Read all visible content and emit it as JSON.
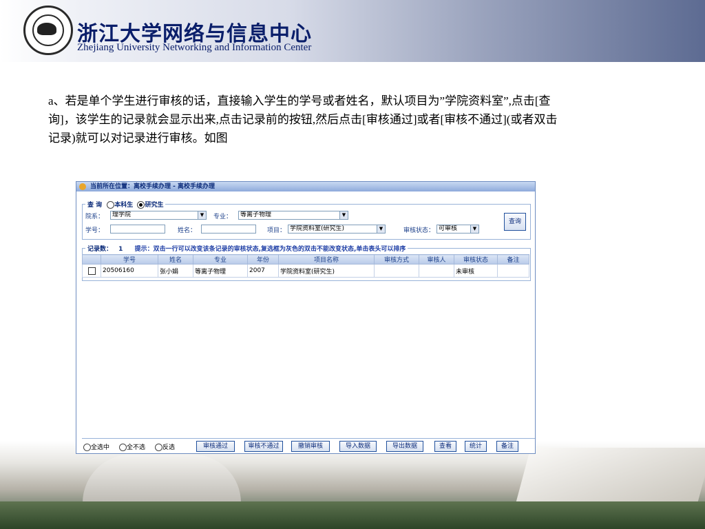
{
  "header": {
    "title_cn": "浙江大学网络与信息中心",
    "title_en": "Zhejiang University Networking and Information Center"
  },
  "paragraph": "a、若是单个学生进行审核的话，直接输入学生的学号或者姓名，默认项目为”学院资料室”,点击[查询]，该学生的记录就会显示出来,点击记录前的按钮,然后点击[审核通过]或者[审核不通过](或者双击记录)就可以对记录进行审核。如图",
  "app": {
    "location": "当前所在位置：离校手续办理 - 离校手续办理",
    "query": {
      "legend": "查 询",
      "opt_undergrad": "本科生",
      "opt_grad": "研究生",
      "dept_label": "院系：",
      "dept_value": "理学院",
      "major_label": "专业：",
      "major_value": "等离子物理",
      "id_label": "学号：",
      "id_value": "",
      "name_label": "姓名：",
      "name_value": "",
      "project_label": "项目：",
      "project_value": "学院资料室(研究生)",
      "status_label": "审核状态：",
      "status_value": "可审核",
      "query_button": "查询"
    },
    "records": {
      "count_label": "记录数：",
      "count": "1",
      "hint": "提示：双击一行可以改变该条记录的审核状态,复选框为灰色的双击不能改变状态,单击表头可以排序",
      "columns": [
        "学号",
        "姓名",
        "专业",
        "年份",
        "项目名称",
        "审核方式",
        "审核人",
        "审核状态",
        "备注"
      ],
      "rows": [
        [
          "20506160",
          "张小娟",
          "等离子物理",
          "2007",
          "学院资料室(研究生)",
          "",
          "",
          "未审核",
          ""
        ]
      ]
    },
    "bottom": {
      "select_all": "全选中",
      "select_none": "全不选",
      "invert": "反选",
      "buttons": [
        "审核通过",
        "审核不通过",
        "撤销审核",
        "导入数据",
        "导出数据",
        "查看",
        "统计",
        "备注"
      ]
    }
  }
}
